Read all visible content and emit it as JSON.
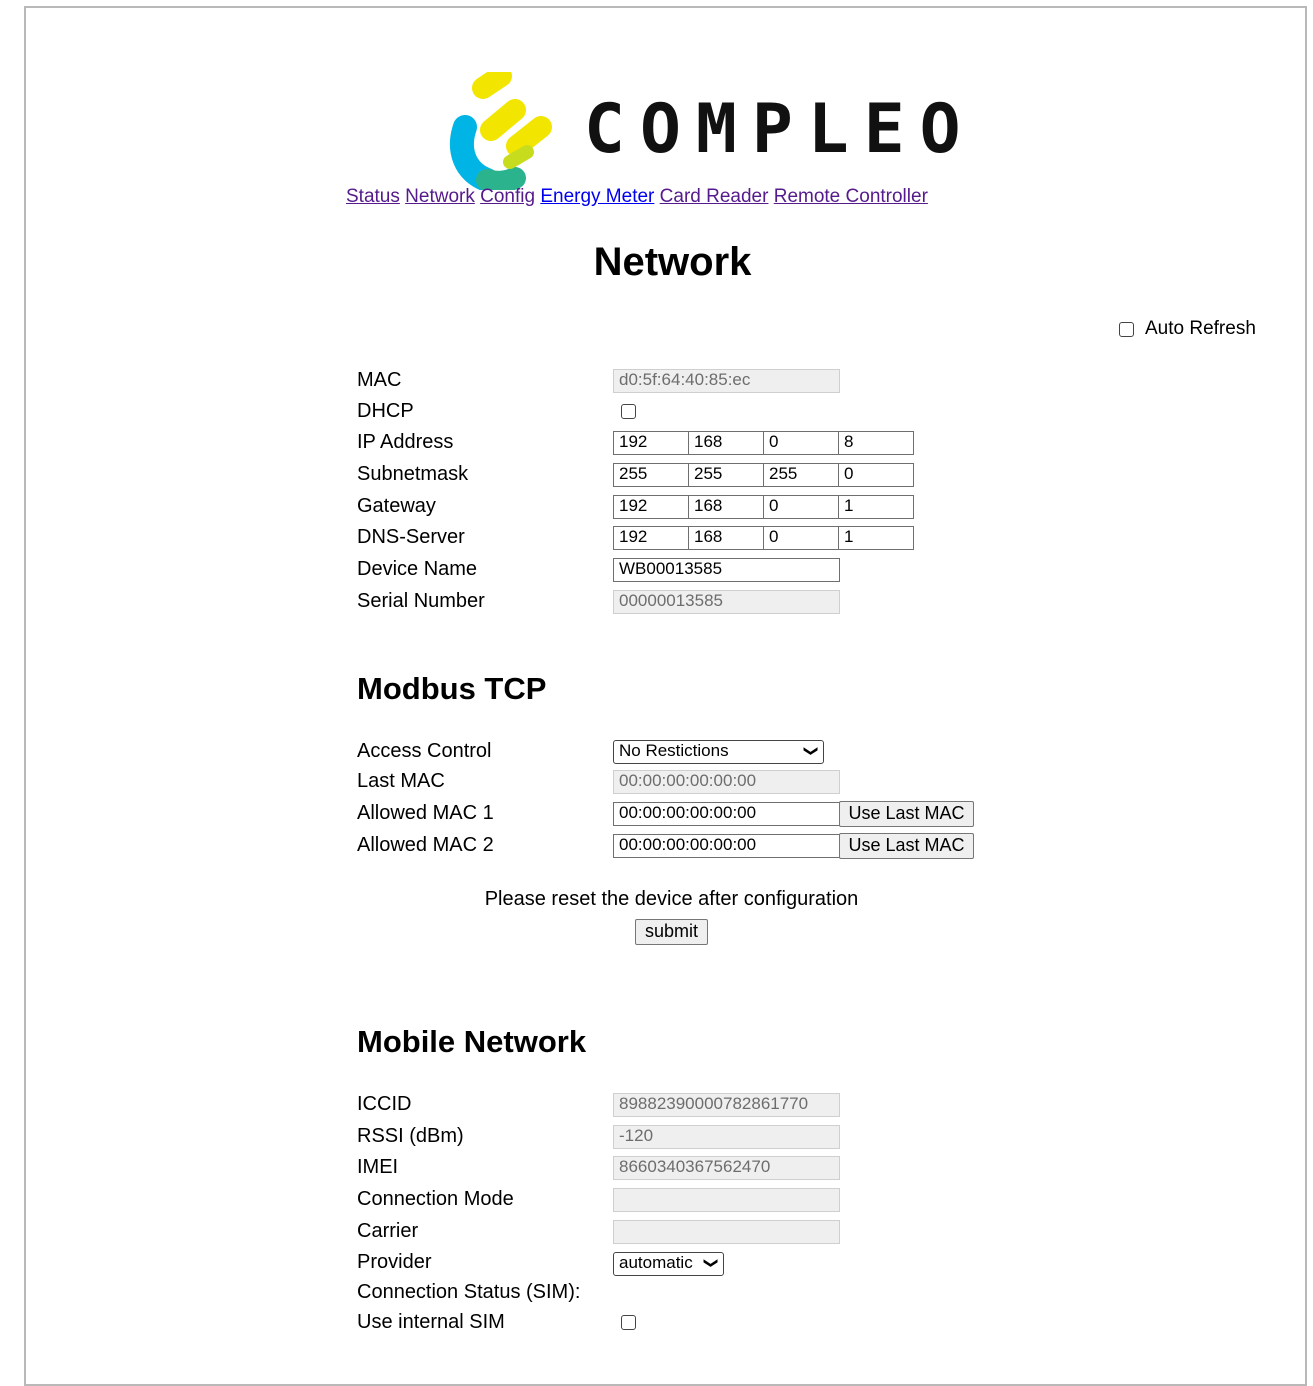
{
  "brand": {
    "name": "COMPLEO",
    "colors": {
      "yellow": "#f2e600",
      "cyan": "#00b4e6",
      "teal": "#2bb38d"
    }
  },
  "nav": [
    {
      "label": "Status"
    },
    {
      "label": "Network"
    },
    {
      "label": "Config"
    },
    {
      "label": "Energy Meter"
    },
    {
      "label": "Card Reader"
    },
    {
      "label": "Remote Controller"
    }
  ],
  "page_title": "Network",
  "auto_refresh": {
    "label": "Auto Refresh",
    "checked": false
  },
  "network": {
    "mac": {
      "label": "MAC",
      "value": "d0:5f:64:40:85:ec"
    },
    "dhcp": {
      "label": "DHCP",
      "checked": false
    },
    "ip": {
      "label": "IP Address",
      "octets": [
        "192",
        "168",
        "0",
        "8"
      ]
    },
    "subnet": {
      "label": "Subnetmask",
      "octets": [
        "255",
        "255",
        "255",
        "0"
      ]
    },
    "gateway": {
      "label": "Gateway",
      "octets": [
        "192",
        "168",
        "0",
        "1"
      ]
    },
    "dns": {
      "label": "DNS-Server",
      "octets": [
        "192",
        "168",
        "0",
        "1"
      ]
    },
    "device_name": {
      "label": "Device Name",
      "value": "WB00013585"
    },
    "serial": {
      "label": "Serial Number",
      "value": "00000013585"
    }
  },
  "modbus": {
    "title": "Modbus TCP",
    "access_control": {
      "label": "Access Control",
      "value": "No Restictions"
    },
    "last_mac": {
      "label": "Last MAC",
      "value": "00:00:00:00:00:00"
    },
    "allowed1": {
      "label": "Allowed MAC 1",
      "value": "00:00:00:00:00:00",
      "button": "Use Last MAC"
    },
    "allowed2": {
      "label": "Allowed MAC 2",
      "value": "00:00:00:00:00:00",
      "button": "Use Last MAC"
    }
  },
  "reset_note": "Please reset the device after configuration",
  "submit_label": "submit",
  "mobile": {
    "title": "Mobile Network",
    "iccid": {
      "label": "ICCID",
      "value": "89882390000782861770"
    },
    "rssi": {
      "label": "RSSI (dBm)",
      "value": "-120"
    },
    "imei": {
      "label": "IMEI",
      "value": "8660340367562470"
    },
    "connection_mode": {
      "label": "Connection Mode",
      "value": ""
    },
    "carrier": {
      "label": "Carrier",
      "value": ""
    },
    "provider": {
      "label": "Provider",
      "value": "automatic"
    },
    "connection_status": {
      "label": "Connection Status (SIM):"
    },
    "internal_sim": {
      "label": "Use internal SIM",
      "checked": false
    }
  }
}
